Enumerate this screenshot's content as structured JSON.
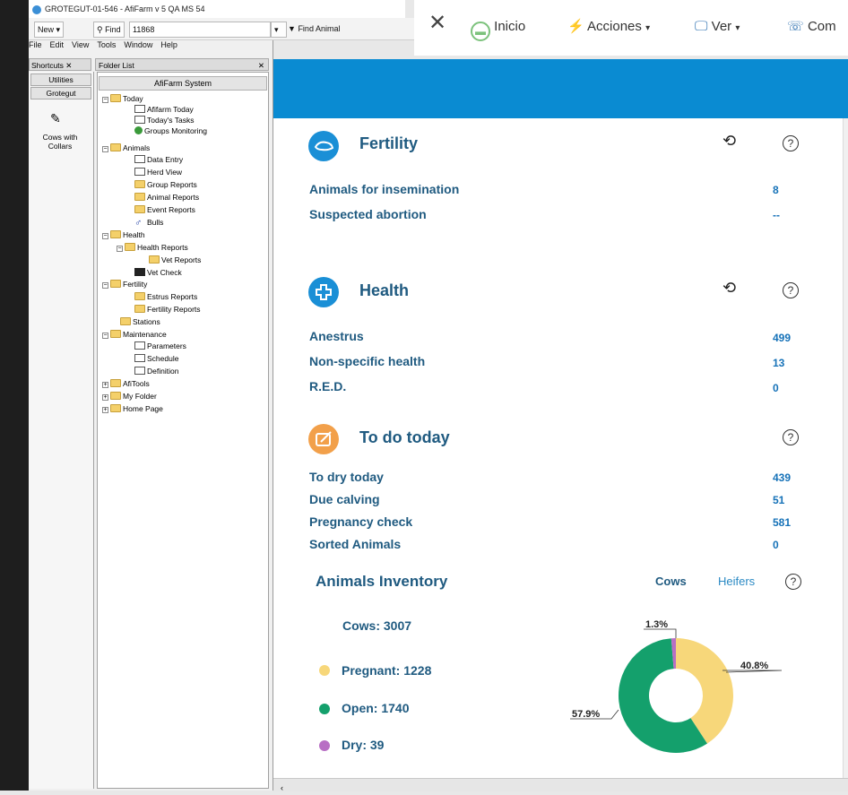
{
  "window": {
    "title": "GROTEGUT-01-546 - AfiFarm v 5 QA MS 54"
  },
  "toolbar": {
    "new_label": "New",
    "find_label": "Find",
    "find_value": "11868",
    "find_animal_label": "Find Animal"
  },
  "menu": [
    "File",
    "Edit",
    "View",
    "Tools",
    "Window",
    "Help"
  ],
  "shortcuts": {
    "header": "Shortcuts",
    "utilities": "Utilities",
    "grotegut": "Grotegut",
    "item_label": "Cows with Collars"
  },
  "folder_list": {
    "header": "Folder List",
    "root": "AfiFarm System",
    "items": [
      "Today",
      "Afifarm Today",
      "Today's Tasks",
      "Groups Monitoring",
      "Animals",
      "Data Entry",
      "Herd View",
      "Group Reports",
      "Animal Reports",
      "Event Reports",
      "Bulls",
      "Health",
      "Health Reports",
      "Vet Reports",
      "Vet Check",
      "Fertility",
      "Estrus Reports",
      "Fertility Reports",
      "Stations",
      "Maintenance",
      "Parameters",
      "Schedule",
      "Definition",
      "AfiTools",
      "My Folder",
      "Home Page"
    ]
  },
  "app_toolbar": {
    "inicio": "Inicio",
    "acciones": "Acciones",
    "ver": "Ver",
    "com": "Com"
  },
  "fertility": {
    "title": "Fertility",
    "rows": [
      {
        "label": "Animals for insemination",
        "value": "8"
      },
      {
        "label": "Suspected abortion",
        "value": "--"
      }
    ]
  },
  "health": {
    "title": "Health",
    "rows": [
      {
        "label": "Anestrus",
        "value": "499"
      },
      {
        "label": "Non-specific health",
        "value": "13"
      },
      {
        "label": "R.E.D.",
        "value": "0"
      }
    ]
  },
  "todo": {
    "title": "To do today",
    "rows": [
      {
        "label": "To dry today",
        "value": "439"
      },
      {
        "label": "Due calving",
        "value": "51"
      },
      {
        "label": "Pregnancy check",
        "value": "581"
      },
      {
        "label": "Sorted Animals",
        "value": "0"
      }
    ]
  },
  "inventory": {
    "title": "Animals Inventory",
    "tab_cows": "Cows",
    "tab_heifers": "Heifers",
    "total": "Cows: 3007",
    "legend": [
      {
        "label": "Pregnant: 1228",
        "color": "#f7d77a"
      },
      {
        "label": "Open: 1740",
        "color": "#14a06c"
      },
      {
        "label": "Dry: 39",
        "color": "#b86fc4"
      }
    ]
  },
  "chart_data": {
    "type": "pie",
    "categories": [
      "Pregnant",
      "Open",
      "Dry"
    ],
    "values": [
      40.8,
      57.9,
      1.3
    ],
    "labels": [
      "40.8%",
      "57.9%",
      "1.3%"
    ],
    "colors": [
      "#f7d77a",
      "#14a06c",
      "#b86fc4"
    ]
  },
  "colors": {
    "header_blue": "#0a8bd2",
    "fertility_icon": "#1a8fd6",
    "health_icon": "#1a8fd6",
    "todo_icon": "#f2a04a"
  }
}
